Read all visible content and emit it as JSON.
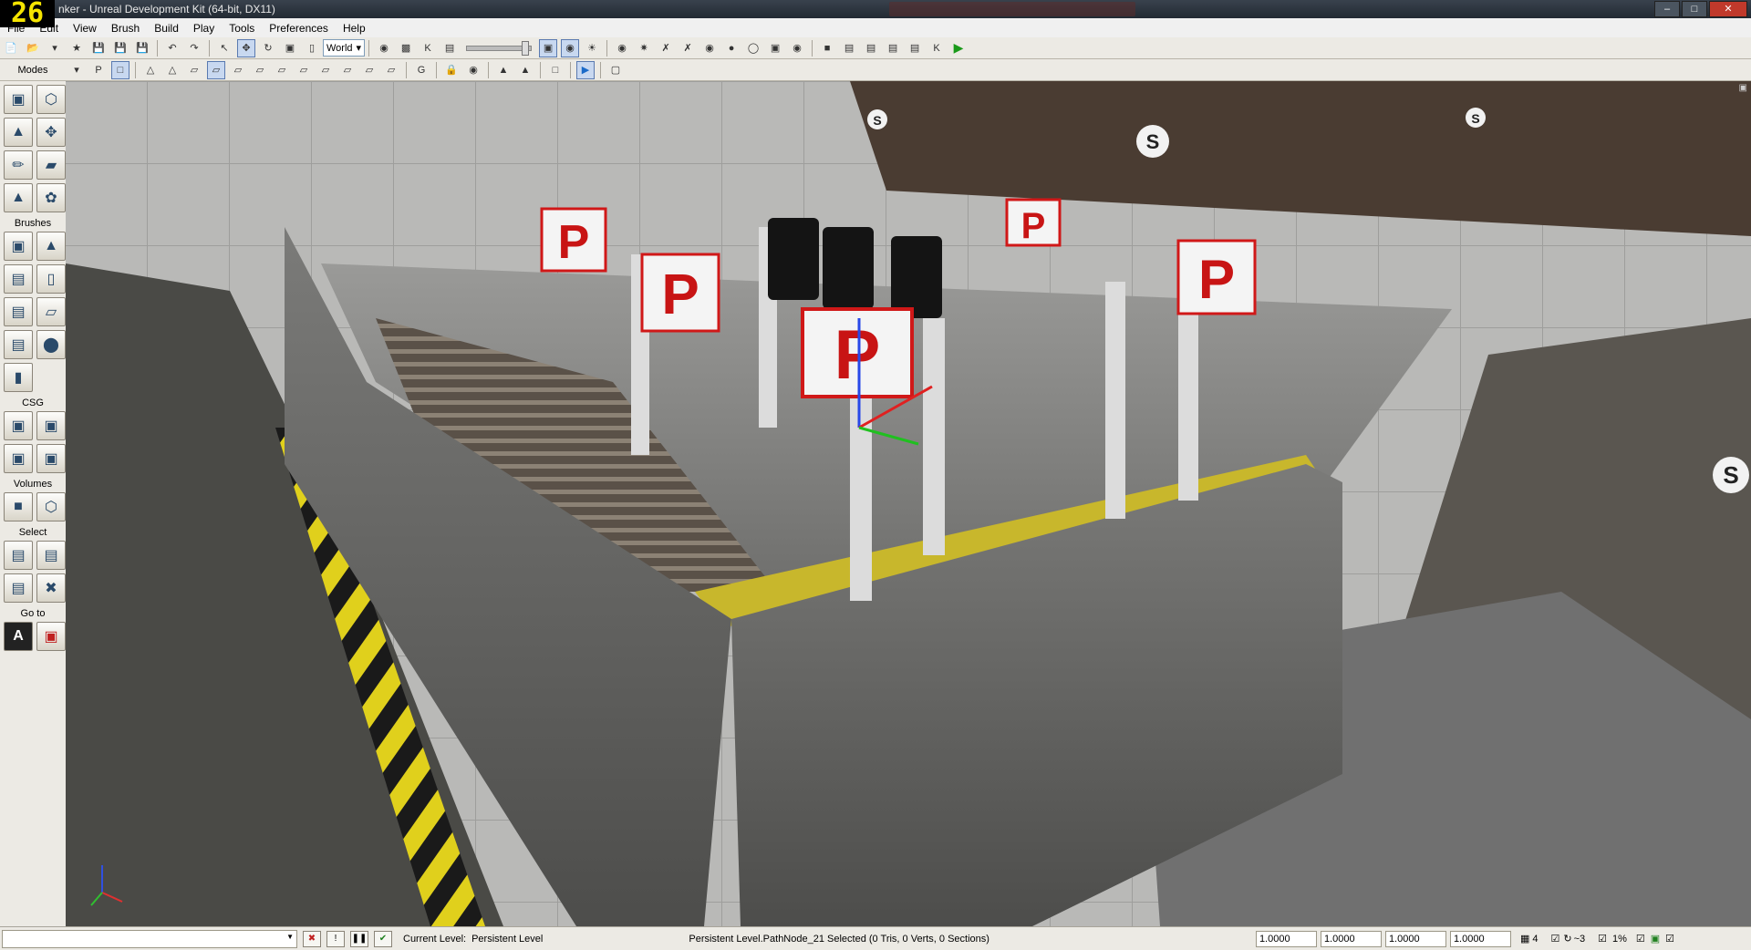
{
  "titlebar": {
    "fps": "26",
    "title": "nker - Unreal Development Kit (64-bit, DX11)"
  },
  "menu": {
    "items": [
      "File",
      "Edit",
      "View",
      "Brush",
      "Build",
      "Play",
      "Tools",
      "Preferences",
      "Help"
    ]
  },
  "toolbar": {
    "coord_system": "World"
  },
  "left_panel": {
    "modes_label": "Modes",
    "brushes_label": "Brushes",
    "csg_label": "CSG",
    "volumes_label": "Volumes",
    "select_label": "Select",
    "goto_label": "Go to"
  },
  "viewport": {
    "billboard_letter": "S",
    "sign_letter": "P"
  },
  "status": {
    "current_level_label": "Current Level:",
    "current_level_value": "Persistent Level",
    "selection_text": "Persistent Level.PathNode_21 Selected (0 Tris, 0 Verts, 0 Sections)",
    "drag_grid": [
      "1.0000",
      "1.0000",
      "1.0000",
      "1.0000"
    ],
    "grid_size": "4",
    "rotation_snap": "~3",
    "scale_snap": "1%"
  }
}
